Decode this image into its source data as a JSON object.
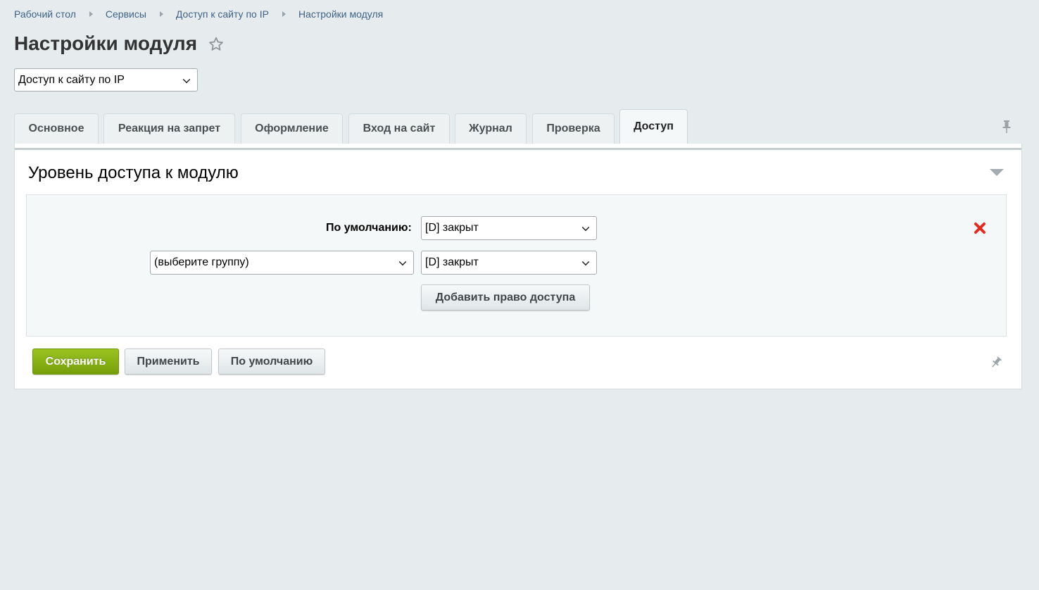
{
  "breadcrumb": [
    "Рабочий стол",
    "Сервисы",
    "Доступ к сайту по IP",
    "Настройки модуля"
  ],
  "page_title": "Настройки модуля",
  "module_select": {
    "value": "Доступ к сайту по IP"
  },
  "tabs": [
    {
      "label": "Основное",
      "active": false
    },
    {
      "label": "Реакция на запрет",
      "active": false
    },
    {
      "label": "Оформление",
      "active": false
    },
    {
      "label": "Вход на сайт",
      "active": false
    },
    {
      "label": "Журнал",
      "active": false
    },
    {
      "label": "Проверка",
      "active": false
    },
    {
      "label": "Доступ",
      "active": true
    }
  ],
  "section": {
    "title": "Уровень доступа к модулю",
    "default_label": "По умолчанию:",
    "default_value": "[D] закрыт",
    "group_value": "(выберите группу)",
    "group_access_value": "[D] закрыт",
    "add_button": "Добавить право доступа"
  },
  "footer": {
    "save": "Сохранить",
    "apply": "Применить",
    "defaults": "По умолчанию"
  },
  "icons": {
    "favorite": "star-icon",
    "pin": "pin-icon",
    "collapse": "triangle-down-icon",
    "delete": "red-x-icon"
  },
  "colors": {
    "primary_button": "#86b014",
    "link": "#3f6286",
    "delete": "#e22b1b"
  }
}
